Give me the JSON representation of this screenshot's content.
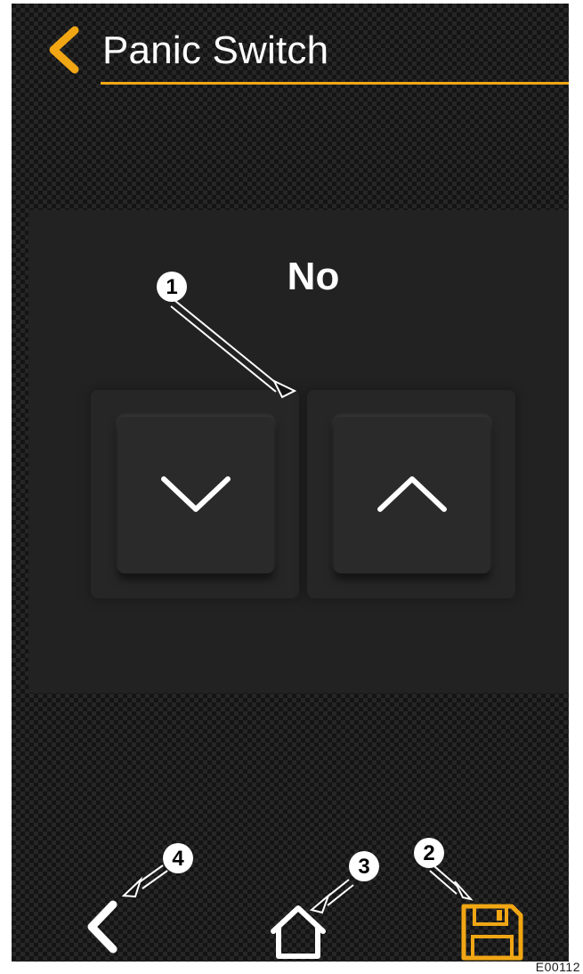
{
  "header": {
    "title": "Panic Switch",
    "back_icon": "chevron-left-icon"
  },
  "setting": {
    "value": "No",
    "decrease_icon": "chevron-down-icon",
    "increase_icon": "chevron-up-icon"
  },
  "callouts": [
    "1",
    "2",
    "3",
    "4"
  ],
  "bottom_nav": {
    "back_icon": "chevron-left-icon",
    "home_icon": "home-icon",
    "save_icon": "floppy-disk-icon"
  },
  "reference_code": "E00112",
  "colors": {
    "accent": "#f1a614",
    "background": "#141414",
    "panel": "#222222",
    "button": "#2a2a2a",
    "text": "#ffffff"
  }
}
